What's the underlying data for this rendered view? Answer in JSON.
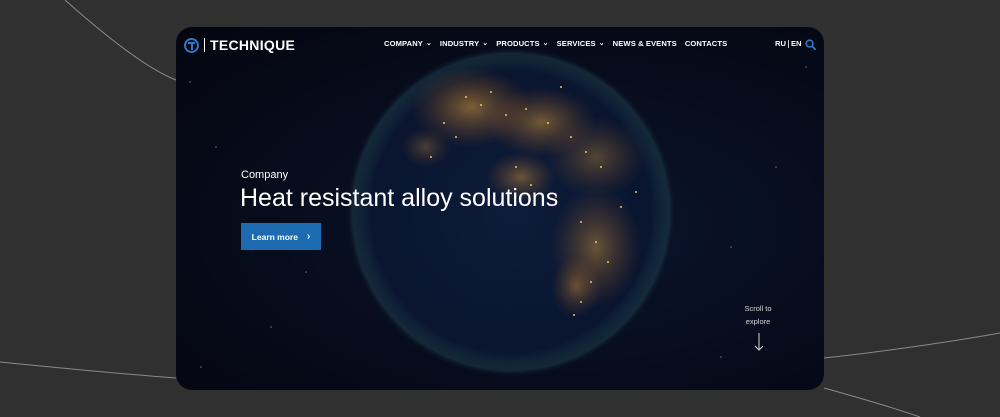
{
  "brand": {
    "name": "TECHNIQUE",
    "accent": "#2f78c4"
  },
  "nav": {
    "items": [
      {
        "label": "COMPANY",
        "dropdown": true
      },
      {
        "label": "INDUSTRY",
        "dropdown": true
      },
      {
        "label": "PRODUCTS",
        "dropdown": true
      },
      {
        "label": "SERVICES",
        "dropdown": true
      },
      {
        "label": "NEWS & EVENTS",
        "dropdown": false
      },
      {
        "label": "CONTACTS",
        "dropdown": false
      }
    ],
    "chevron": "⌄"
  },
  "lang": {
    "ru": "RU",
    "en": "EN"
  },
  "icons": {
    "search": "search-icon",
    "scroll": "arrow-down-icon",
    "cta": "chevron-right-icon"
  },
  "hero": {
    "eyebrow": "Company",
    "title": "Heat resistant alloy solutions",
    "cta_label": "Learn more",
    "cta_arrow": "›",
    "cta_color": "#1d6cb2"
  },
  "scroll": {
    "line1": "Scroll to",
    "line2": "explore"
  }
}
